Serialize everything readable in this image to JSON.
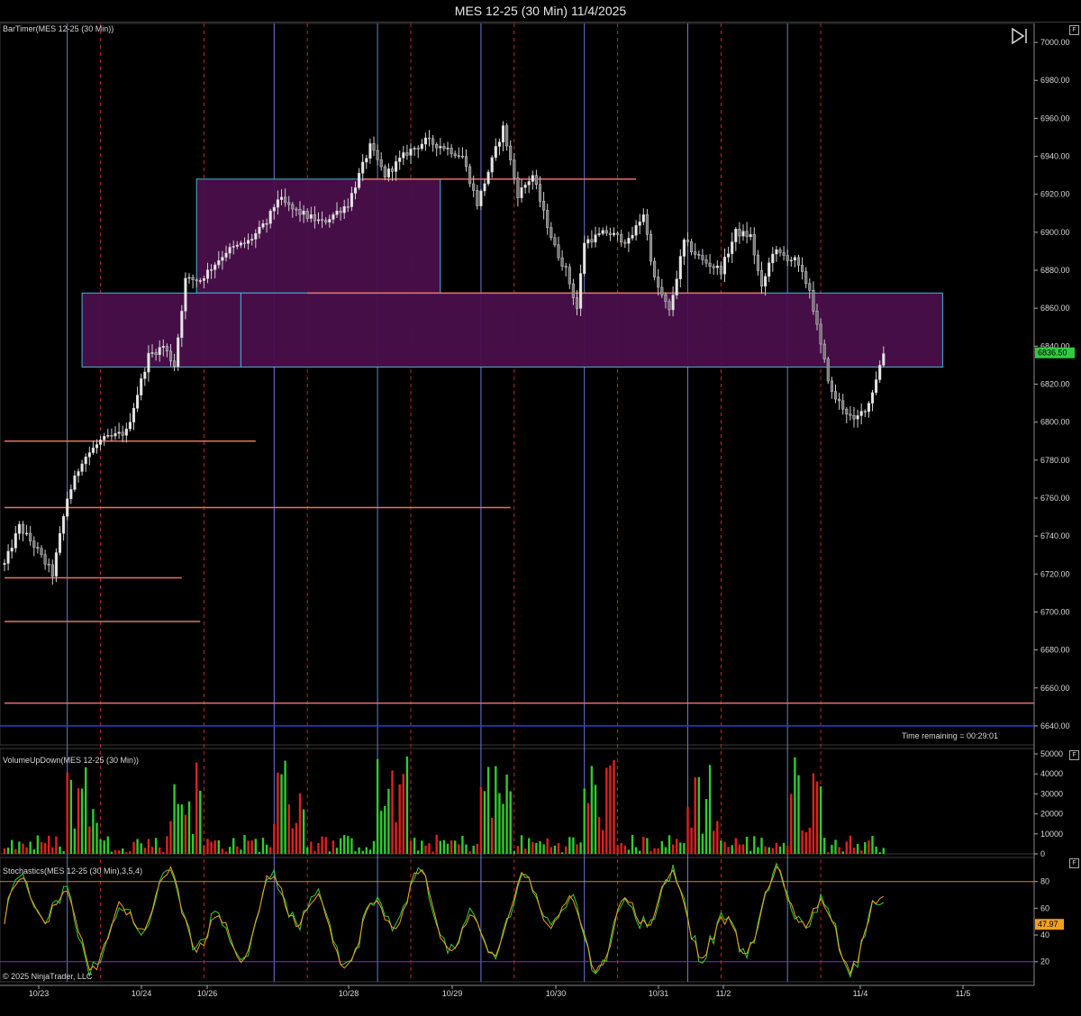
{
  "window": {
    "title": "MES 12-25 (30 Min)  11/4/2025"
  },
  "panels": {
    "price": {
      "label": "BarTimer(MES 12-25 (30 Min))",
      "time_remaining": "Time remaining = 00:29:01"
    },
    "volume": {
      "label": "VolumeUpDown(MES 12-25 (30 Min))"
    },
    "stoch": {
      "label": "Stochastics(MES 12-25 (30 Min),3,5,4)"
    }
  },
  "copyright": "© 2025 NinjaTrader, LLC",
  "colors": {
    "background": "#000000",
    "zone_fill": "#4a0f4a",
    "zone_border": "#3fb6d8",
    "level_line": "#e8706a",
    "session_line": "#6a78d8",
    "day_line": "#c0282a",
    "price_tag": "#2ecc40",
    "stoch_tag": "#f0a020",
    "volume_up": "#2ecc2e",
    "volume_down": "#e02020"
  },
  "chart_data": [
    {
      "type": "candlestick",
      "title": "MES 12-25 (30 Min)  11/4/2025",
      "ylim": [
        6630,
        7010
      ],
      "yticks": [
        7000,
        6980,
        6960,
        6940,
        6920,
        6900,
        6880,
        6860,
        6840,
        6820,
        6800,
        6780,
        6760,
        6740,
        6720,
        6700,
        6680,
        6660,
        6640
      ],
      "ytick_labels": [
        "7000.00",
        "6980.00",
        "6960.00",
        "6940.00",
        "6920.00",
        "6900.00",
        "6880.00",
        "6860.00",
        "6840.00",
        "6820.00",
        "6800.00",
        "6780.00",
        "6760.00",
        "6740.00",
        "6720.00",
        "6700.00",
        "6680.00",
        "6660.00",
        "6640.00"
      ],
      "last_price": "6836.50",
      "x_labels": [
        "10/23",
        "10/24",
        "10/26",
        "10/28",
        "10/29",
        "10/30",
        "10/31",
        "11/2",
        "11/4",
        "11/5"
      ],
      "price_path": [
        [
          0,
          6725
        ],
        [
          4,
          6745
        ],
        [
          8,
          6735
        ],
        [
          13,
          6720
        ],
        [
          17,
          6760
        ],
        [
          21,
          6780
        ],
        [
          26,
          6790
        ],
        [
          33,
          6795
        ],
        [
          39,
          6835
        ],
        [
          43,
          6840
        ],
        [
          46,
          6830
        ],
        [
          49,
          6875
        ],
        [
          53,
          6875
        ],
        [
          60,
          6890
        ],
        [
          66,
          6895
        ],
        [
          71,
          6905
        ],
        [
          74,
          6918
        ],
        [
          78,
          6912
        ],
        [
          86,
          6905
        ],
        [
          93,
          6915
        ],
        [
          99,
          6945
        ],
        [
          103,
          6930
        ],
        [
          109,
          6942
        ],
        [
          114,
          6948
        ],
        [
          119,
          6945
        ],
        [
          124,
          6940
        ],
        [
          128,
          6915
        ],
        [
          131,
          6932
        ],
        [
          135,
          6955
        ],
        [
          139,
          6920
        ],
        [
          143,
          6930
        ],
        [
          146,
          6910
        ],
        [
          149,
          6892
        ],
        [
          152,
          6880
        ],
        [
          155,
          6860
        ],
        [
          157,
          6895
        ],
        [
          163,
          6900
        ],
        [
          169,
          6895
        ],
        [
          173,
          6910
        ],
        [
          176,
          6875
        ],
        [
          180,
          6858
        ],
        [
          184,
          6895
        ],
        [
          189,
          6885
        ],
        [
          194,
          6880
        ],
        [
          198,
          6900
        ],
        [
          202,
          6898
        ],
        [
          205,
          6870
        ],
        [
          208,
          6890
        ],
        [
          214,
          6885
        ],
        [
          218,
          6870
        ],
        [
          221,
          6840
        ],
        [
          224,
          6815
        ],
        [
          227,
          6808
        ],
        [
          230,
          6800
        ],
        [
          234,
          6810
        ],
        [
          238,
          6836.5
        ]
      ],
      "horizontal_levels": [
        6928,
        6868,
        6790,
        6755,
        6718,
        6695,
        6652
      ],
      "blue_level": 6640,
      "zones": [
        {
          "from": 6868,
          "to": 6928
        },
        {
          "from": 6829,
          "to": 6868
        },
        {
          "from": 6829,
          "to": 6868
        }
      ]
    },
    {
      "type": "bar",
      "title": "VolumeUpDown(MES 12-25 (30 Min))",
      "ylim": [
        0,
        50000
      ],
      "yticks": [
        50000,
        40000,
        30000,
        20000,
        10000,
        0
      ],
      "ytick_labels": [
        "50000",
        "40000",
        "30000",
        "20000",
        "10000",
        "0"
      ],
      "series": [
        {
          "name": "Up",
          "color": "#2ecc2e"
        },
        {
          "name": "Down",
          "color": "#e02020"
        }
      ]
    },
    {
      "type": "line",
      "title": "Stochastics(MES 12-25 (30 Min),3,5,4)",
      "ylim": [
        5,
        98
      ],
      "yticks": [
        80,
        60,
        40,
        20
      ],
      "ytick_labels": [
        "80",
        "60",
        "40",
        "20"
      ],
      "bands": [
        80,
        20
      ],
      "last_value": "47.97"
    }
  ]
}
